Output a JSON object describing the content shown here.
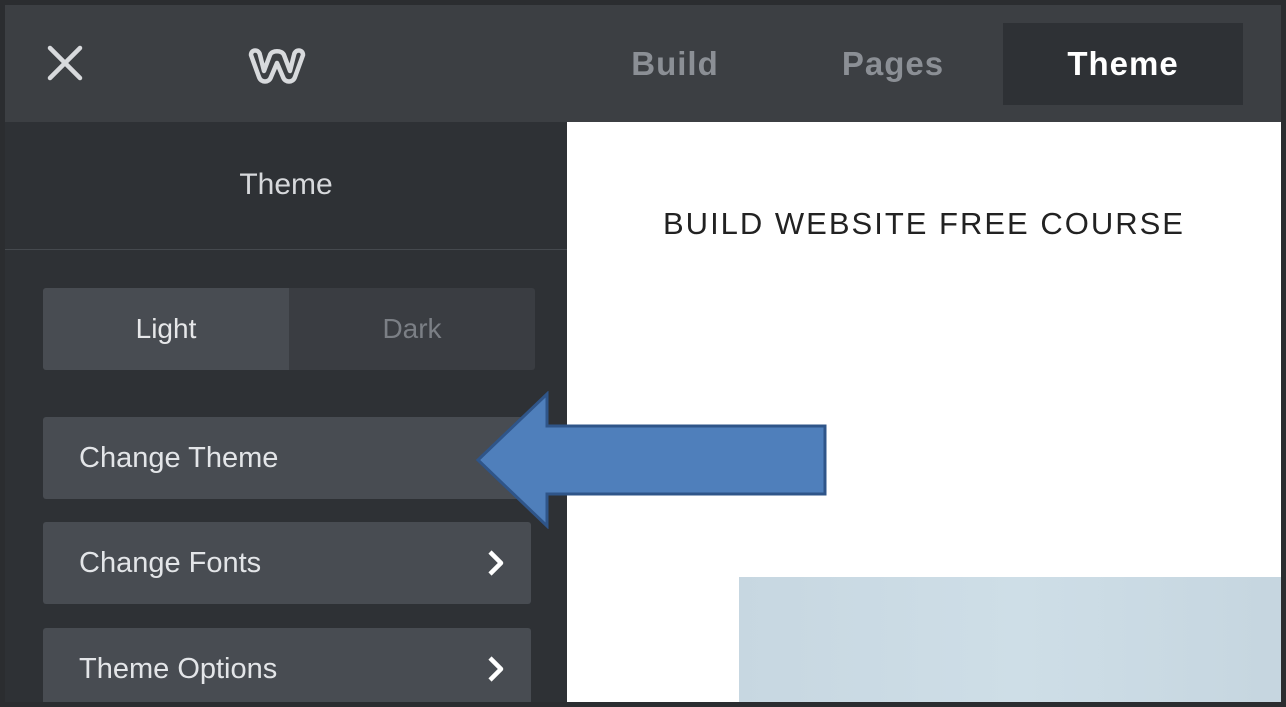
{
  "topbar": {
    "tabs": [
      {
        "label": "Build"
      },
      {
        "label": "Pages"
      },
      {
        "label": "Theme",
        "active": true
      }
    ]
  },
  "sidebar": {
    "title": "Theme",
    "toggle": {
      "light": "Light",
      "dark": "Dark",
      "selected": "Light"
    },
    "items": [
      {
        "label": "Change Theme"
      },
      {
        "label": "Change Fonts"
      },
      {
        "label": "Theme Options"
      }
    ]
  },
  "canvas": {
    "site_title": "BUILD WEBSITE FREE COURSE"
  },
  "icons": {
    "close": "close-icon",
    "logo": "weebly-logo-icon",
    "chevron": "chevron-right-icon"
  },
  "colors": {
    "topbar_bg": "#3c3f43",
    "sidebar_bg": "#2e3135",
    "menu_item_bg": "#484c52",
    "arrow_fill": "#4f7fbb",
    "arrow_stroke": "#2f5589"
  }
}
